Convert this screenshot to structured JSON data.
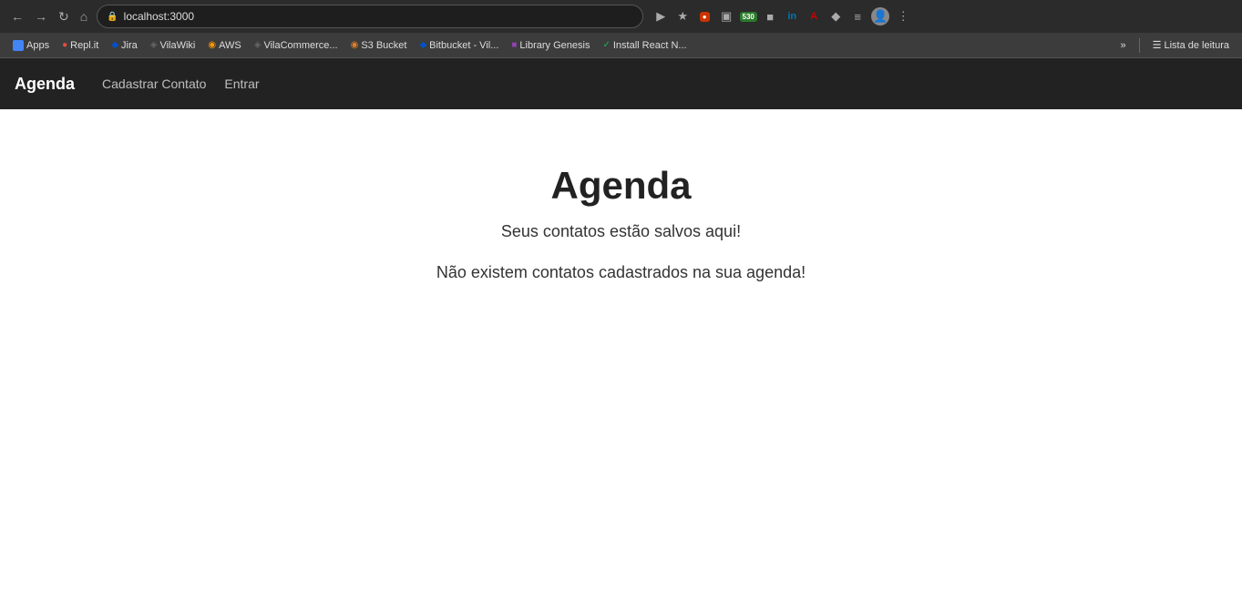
{
  "browser": {
    "url": "localhost:3000",
    "nav_back": "←",
    "nav_forward": "→",
    "nav_reload": "↻",
    "nav_home": "⌂"
  },
  "bookmarks": {
    "items": [
      {
        "id": "apps",
        "label": "Apps",
        "icon": "⊞",
        "color": "#4285f4"
      },
      {
        "id": "replit",
        "label": "Repl.it",
        "icon": "●",
        "color": "#e74c3c"
      },
      {
        "id": "jira",
        "label": "Jira",
        "icon": "◆",
        "color": "#0052cc"
      },
      {
        "id": "vilawiki",
        "label": "VilaWiki",
        "icon": "◈",
        "color": "#666"
      },
      {
        "id": "aws",
        "label": "AWS",
        "icon": "◉",
        "color": "#ff9900"
      },
      {
        "id": "vilacommerce",
        "label": "VilaCommerce...",
        "icon": "◈",
        "color": "#666"
      },
      {
        "id": "s3bucket",
        "label": "S3 Bucket",
        "icon": "◉",
        "color": "#e67e22"
      },
      {
        "id": "bitbucket",
        "label": "Bitbucket - Vil...",
        "icon": "◆",
        "color": "#0052cc"
      },
      {
        "id": "librarygen",
        "label": "Library Genesis",
        "icon": "■",
        "color": "#8e44ad"
      },
      {
        "id": "installreact",
        "label": "Install React N...",
        "icon": "✓",
        "color": "#27ae60"
      }
    ],
    "more_label": "»",
    "lista_label": "Lista de leitura"
  },
  "navbar": {
    "brand": "Agenda",
    "links": [
      {
        "id": "cadastrar",
        "label": "Cadastrar Contato"
      },
      {
        "id": "entrar",
        "label": "Entrar"
      }
    ]
  },
  "main": {
    "title": "Agenda",
    "subtitle": "Seus contatos estão salvos aqui!",
    "empty_message": "Não existem contatos cadastrados na sua agenda!"
  }
}
